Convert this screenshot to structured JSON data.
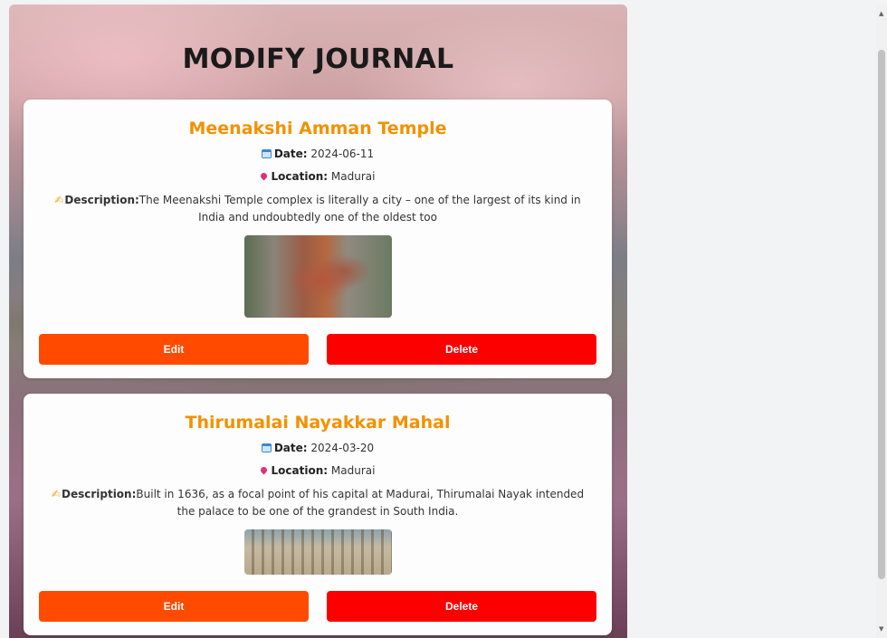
{
  "page": {
    "title": "MODIFY JOURNAL"
  },
  "entries": [
    {
      "title": "Meenakshi Amman Temple",
      "date_label": "Date:",
      "date": "2024-06-11",
      "location_label": "Location:",
      "location": "Madurai",
      "description_label": "Description:",
      "description": "The Meenakshi Temple complex is literally a city – one of the largest of its kind in India and undoubtedly one of the oldest too",
      "image_icon": "temple-photo",
      "edit_label": "Edit",
      "delete_label": "Delete"
    },
    {
      "title": "Thirumalai Nayakkar Mahal",
      "date_label": "Date:",
      "date": "2024-03-20",
      "location_label": "Location:",
      "location": "Madurai",
      "description_label": "Description:",
      "description": "Built in 1636, as a focal point of his capital at Madurai, Thirumalai Nayak intended the palace to be one of the grandest in South India.",
      "image_icon": "palace-photo",
      "edit_label": "Edit",
      "delete_label": "Delete"
    }
  ],
  "colors": {
    "title_text": "#1a1a1a",
    "entry_title": "#f39100",
    "edit_button": "#ff4a00",
    "delete_button": "#fc0000"
  },
  "icons": {
    "date": "calendar-icon",
    "location": "pin-icon",
    "description": "writing-hand-icon"
  }
}
